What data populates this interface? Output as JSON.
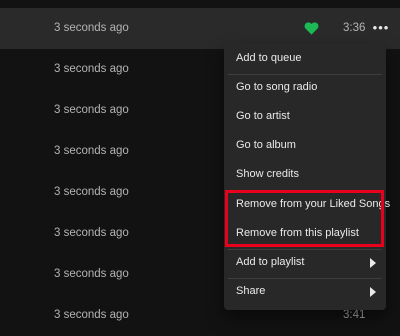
{
  "rows": [
    {
      "added": "3 seconds ago",
      "duration": "3:36",
      "liked": true,
      "more": "•••"
    },
    {
      "added": "3 seconds ago"
    },
    {
      "added": "3 seconds ago"
    },
    {
      "added": "3 seconds ago"
    },
    {
      "added": "3 seconds ago"
    },
    {
      "added": "3 seconds ago"
    },
    {
      "added": "3 seconds ago"
    },
    {
      "added": "3 seconds ago",
      "duration": "3:41"
    }
  ],
  "menu": {
    "items": [
      {
        "label": "Add to queue"
      },
      {
        "label": "Go to song radio"
      },
      {
        "label": "Go to artist"
      },
      {
        "label": "Go to album"
      },
      {
        "label": "Show credits"
      },
      {
        "label": "Remove from your Liked Songs"
      },
      {
        "label": "Remove from this playlist"
      },
      {
        "label": "Add to playlist",
        "submenu": true
      },
      {
        "label": "Share",
        "submenu": true
      }
    ]
  },
  "colors": {
    "liked_heart": "#1db954",
    "highlight_box": "#e8001c"
  }
}
